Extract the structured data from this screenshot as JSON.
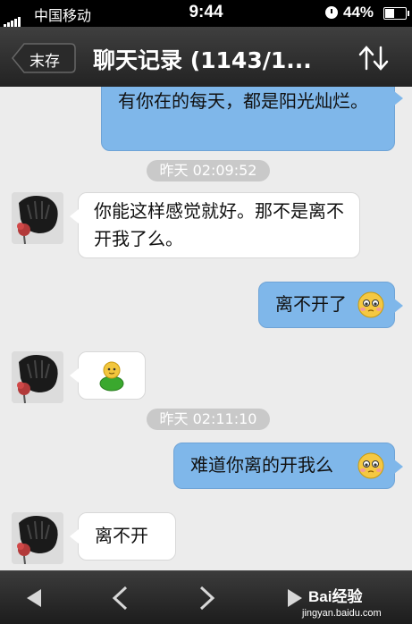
{
  "status_bar": {
    "carrier": "中国移动",
    "time": "9:44",
    "battery": "44%"
  },
  "nav": {
    "back_label": "末存",
    "title": "聊天记录 (1143/1..."
  },
  "messages": [
    {
      "side": "out",
      "text": "有你在的每天，都是阳光灿烂。"
    },
    {
      "timestamp": "昨天 02:09:52"
    },
    {
      "side": "in",
      "text": "你能这样感觉就好。那不是离不开我了么。"
    },
    {
      "side": "out",
      "text": "离不开了",
      "emoji": "shy-face-emoji"
    },
    {
      "side": "in",
      "emoji": "green-figure-emoji"
    },
    {
      "timestamp": "昨天 02:11:10"
    },
    {
      "side": "out",
      "text": "难道你离的开我么",
      "emoji": "shy-face-emoji"
    },
    {
      "side": "in",
      "text": "离不开"
    }
  ],
  "toolbar": {
    "watermark": "Bai经验",
    "watermark_sub": "jingyan.baidu.com"
  },
  "icons": {
    "back": "back-arrow-icon",
    "sort": "swap-arrows-icon",
    "first": "first-page-icon",
    "prev": "chevron-left-icon",
    "next": "chevron-right-icon",
    "last": "last-page-icon"
  },
  "colors": {
    "outgoing_bubble": "#7fb7ea",
    "incoming_bubble": "#ffffff",
    "background": "#ececec",
    "timestamp_pill": "#c9c9c9"
  }
}
